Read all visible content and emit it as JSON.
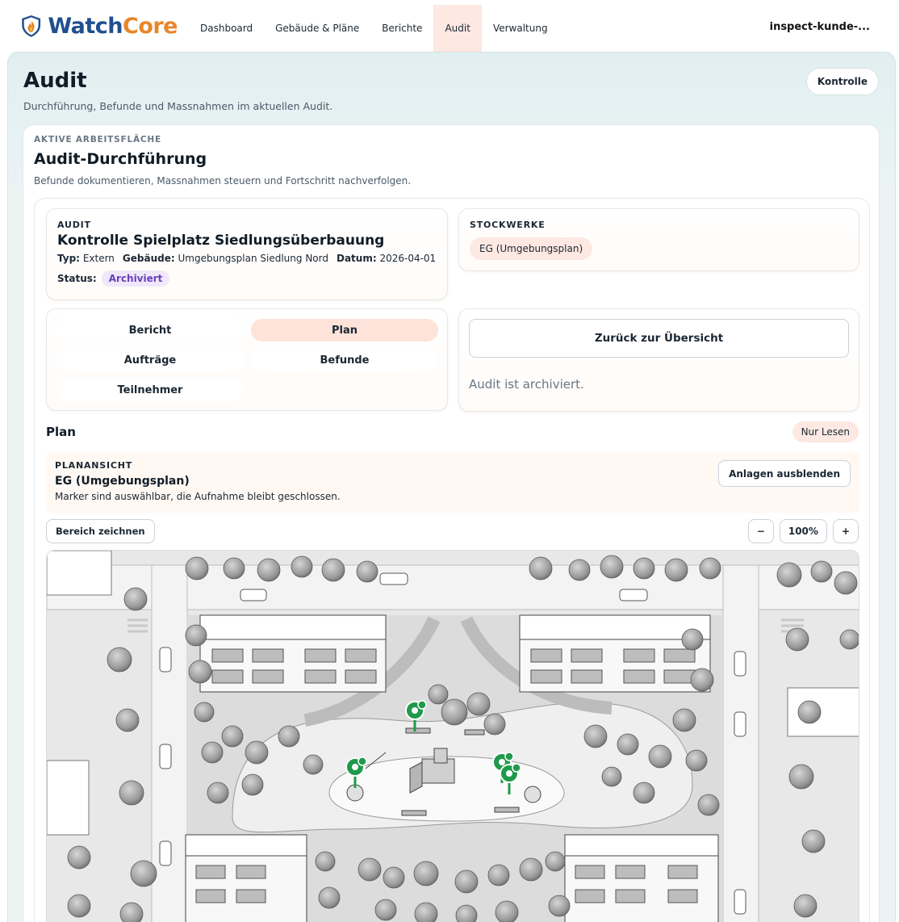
{
  "brand": {
    "name_part1": "Watch",
    "name_part2": "Core"
  },
  "nav": {
    "items": [
      {
        "label": "Dashboard"
      },
      {
        "label": "Gebäude & Pläne"
      },
      {
        "label": "Berichte"
      },
      {
        "label": "Audit"
      },
      {
        "label": "Verwaltung"
      }
    ],
    "active": "Audit",
    "user": "inspect-kunde-..."
  },
  "page": {
    "title": "Audit",
    "subtitle": "Durchführung, Befunde und Massnahmen im aktuellen Audit.",
    "action_label": "Kontrolle"
  },
  "workspace": {
    "eyebrow": "AKTIVE ARBEITSFLÄCHE",
    "title": "Audit-Durchführung",
    "subtitle": "Befunde dokumentieren, Massnahmen steuern und Fortschritt nachverfolgen."
  },
  "audit": {
    "eyebrow": "AUDIT",
    "title": "Kontrolle Spielplatz Siedlungsüberbauung",
    "type_label": "Typ:",
    "type_value": "Extern",
    "building_label": "Gebäude:",
    "building_value": "Umgebungsplan Siedlung Nord",
    "date_label": "Datum:",
    "date_value": "2026-04-01",
    "status_label": "Status:",
    "status_value": "Archiviert",
    "status_color": "#6b3fb8"
  },
  "floors": {
    "eyebrow": "STOCKWERKE",
    "items": [
      {
        "label": "EG (Umgebungsplan)"
      }
    ]
  },
  "tabs": [
    {
      "label": "Bericht",
      "active": false
    },
    {
      "label": "Plan",
      "active": true
    },
    {
      "label": "Aufträge",
      "active": false
    },
    {
      "label": "Befunde",
      "active": false
    },
    {
      "label": "Teilnehmer",
      "active": false
    }
  ],
  "actions": {
    "back_label": "Zurück zur Übersicht",
    "archived_note": "Audit ist archiviert."
  },
  "plan": {
    "heading": "Plan",
    "readonly_badge": "Nur Lesen",
    "view_eyebrow": "PLANANSICHT",
    "view_title": "EG (Umgebungsplan)",
    "view_subtitle": "Marker sind auswählbar, die Aufnahme bleibt geschlossen.",
    "hide_assets_label": "Anlagen ausblenden",
    "draw_area_label": "Bereich zeichnen",
    "zoom_out_label": "−",
    "zoom_level": "100%",
    "zoom_in_label": "+",
    "marker_color": "#1e9a4a",
    "marker_count": 4
  },
  "colors": {
    "accent": "#fde3d9",
    "brand_blue": "#1f4f8f",
    "brand_orange": "#e8862a"
  }
}
